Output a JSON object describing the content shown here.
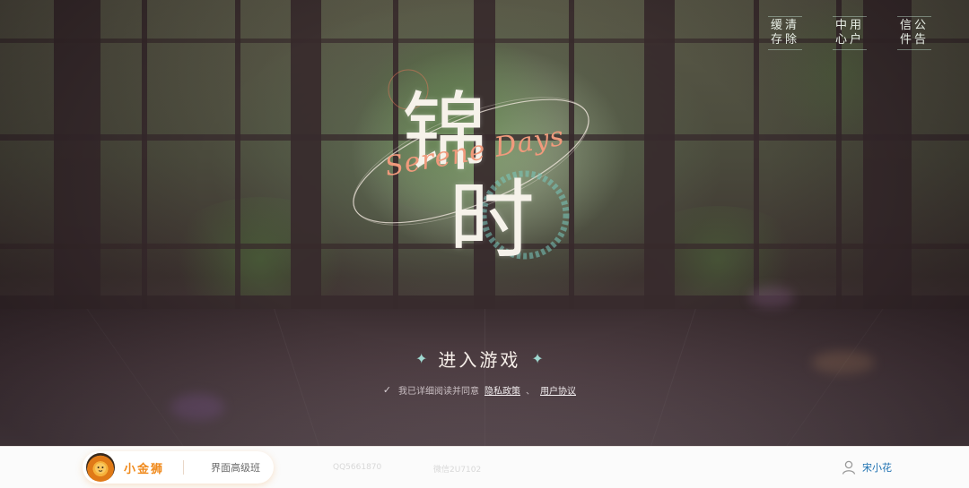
{
  "logo": {
    "title_char_1": "锦",
    "title_char_2": "时",
    "subtitle": "Serene Days"
  },
  "top_menu": [
    {
      "line1": "缓清",
      "line2": "存除"
    },
    {
      "line1": "中用",
      "line2": "心户"
    },
    {
      "line1": "信公",
      "line2": "件告"
    }
  ],
  "enter_game": {
    "label": "进入游戏"
  },
  "agreement": {
    "checked": true,
    "prefix": "我已详细阅读并同意",
    "privacy_link": "隐私政策",
    "separator": "、",
    "terms_link": "用户协议"
  },
  "footer": {
    "brand_name": "小金狮",
    "brand_sub": "界面高级班",
    "faint_1": "QQ5661870",
    "faint_2": "微信2U7102",
    "user_name": "宋小花"
  },
  "colors": {
    "accent_orange": "#f08a1c",
    "logo_salmon": "#f09a7c",
    "spark_teal": "#9fd8d0"
  }
}
